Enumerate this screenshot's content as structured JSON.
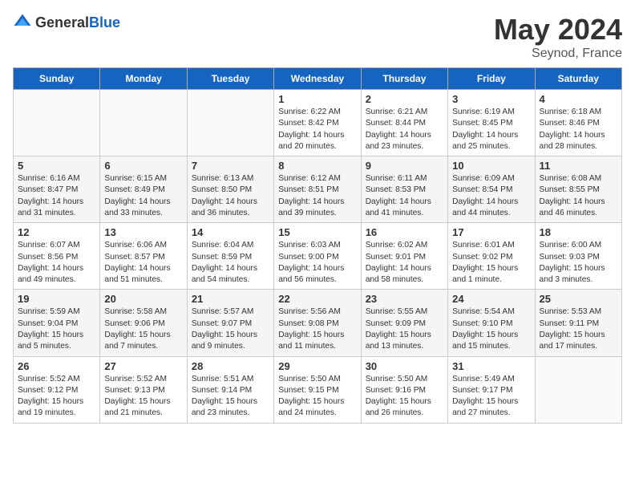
{
  "header": {
    "logo_general": "General",
    "logo_blue": "Blue",
    "main_title": "May 2024",
    "subtitle": "Seynod, France"
  },
  "days_of_week": [
    "Sunday",
    "Monday",
    "Tuesday",
    "Wednesday",
    "Thursday",
    "Friday",
    "Saturday"
  ],
  "weeks": [
    {
      "days": [
        {
          "num": "",
          "empty": true
        },
        {
          "num": "",
          "empty": true
        },
        {
          "num": "",
          "empty": true
        },
        {
          "num": "1",
          "sunrise": "6:22 AM",
          "sunset": "8:42 PM",
          "daylight": "14 hours and 20 minutes."
        },
        {
          "num": "2",
          "sunrise": "6:21 AM",
          "sunset": "8:44 PM",
          "daylight": "14 hours and 23 minutes."
        },
        {
          "num": "3",
          "sunrise": "6:19 AM",
          "sunset": "8:45 PM",
          "daylight": "14 hours and 25 minutes."
        },
        {
          "num": "4",
          "sunrise": "6:18 AM",
          "sunset": "8:46 PM",
          "daylight": "14 hours and 28 minutes."
        }
      ]
    },
    {
      "days": [
        {
          "num": "5",
          "sunrise": "6:16 AM",
          "sunset": "8:47 PM",
          "daylight": "14 hours and 31 minutes."
        },
        {
          "num": "6",
          "sunrise": "6:15 AM",
          "sunset": "8:49 PM",
          "daylight": "14 hours and 33 minutes."
        },
        {
          "num": "7",
          "sunrise": "6:13 AM",
          "sunset": "8:50 PM",
          "daylight": "14 hours and 36 minutes."
        },
        {
          "num": "8",
          "sunrise": "6:12 AM",
          "sunset": "8:51 PM",
          "daylight": "14 hours and 39 minutes."
        },
        {
          "num": "9",
          "sunrise": "6:11 AM",
          "sunset": "8:53 PM",
          "daylight": "14 hours and 41 minutes."
        },
        {
          "num": "10",
          "sunrise": "6:09 AM",
          "sunset": "8:54 PM",
          "daylight": "14 hours and 44 minutes."
        },
        {
          "num": "11",
          "sunrise": "6:08 AM",
          "sunset": "8:55 PM",
          "daylight": "14 hours and 46 minutes."
        }
      ]
    },
    {
      "days": [
        {
          "num": "12",
          "sunrise": "6:07 AM",
          "sunset": "8:56 PM",
          "daylight": "14 hours and 49 minutes."
        },
        {
          "num": "13",
          "sunrise": "6:06 AM",
          "sunset": "8:57 PM",
          "daylight": "14 hours and 51 minutes."
        },
        {
          "num": "14",
          "sunrise": "6:04 AM",
          "sunset": "8:59 PM",
          "daylight": "14 hours and 54 minutes."
        },
        {
          "num": "15",
          "sunrise": "6:03 AM",
          "sunset": "9:00 PM",
          "daylight": "14 hours and 56 minutes."
        },
        {
          "num": "16",
          "sunrise": "6:02 AM",
          "sunset": "9:01 PM",
          "daylight": "14 hours and 58 minutes."
        },
        {
          "num": "17",
          "sunrise": "6:01 AM",
          "sunset": "9:02 PM",
          "daylight": "15 hours and 1 minute."
        },
        {
          "num": "18",
          "sunrise": "6:00 AM",
          "sunset": "9:03 PM",
          "daylight": "15 hours and 3 minutes."
        }
      ]
    },
    {
      "days": [
        {
          "num": "19",
          "sunrise": "5:59 AM",
          "sunset": "9:04 PM",
          "daylight": "15 hours and 5 minutes."
        },
        {
          "num": "20",
          "sunrise": "5:58 AM",
          "sunset": "9:06 PM",
          "daylight": "15 hours and 7 minutes."
        },
        {
          "num": "21",
          "sunrise": "5:57 AM",
          "sunset": "9:07 PM",
          "daylight": "15 hours and 9 minutes."
        },
        {
          "num": "22",
          "sunrise": "5:56 AM",
          "sunset": "9:08 PM",
          "daylight": "15 hours and 11 minutes."
        },
        {
          "num": "23",
          "sunrise": "5:55 AM",
          "sunset": "9:09 PM",
          "daylight": "15 hours and 13 minutes."
        },
        {
          "num": "24",
          "sunrise": "5:54 AM",
          "sunset": "9:10 PM",
          "daylight": "15 hours and 15 minutes."
        },
        {
          "num": "25",
          "sunrise": "5:53 AM",
          "sunset": "9:11 PM",
          "daylight": "15 hours and 17 minutes."
        }
      ]
    },
    {
      "days": [
        {
          "num": "26",
          "sunrise": "5:52 AM",
          "sunset": "9:12 PM",
          "daylight": "15 hours and 19 minutes."
        },
        {
          "num": "27",
          "sunrise": "5:52 AM",
          "sunset": "9:13 PM",
          "daylight": "15 hours and 21 minutes."
        },
        {
          "num": "28",
          "sunrise": "5:51 AM",
          "sunset": "9:14 PM",
          "daylight": "15 hours and 23 minutes."
        },
        {
          "num": "29",
          "sunrise": "5:50 AM",
          "sunset": "9:15 PM",
          "daylight": "15 hours and 24 minutes."
        },
        {
          "num": "30",
          "sunrise": "5:50 AM",
          "sunset": "9:16 PM",
          "daylight": "15 hours and 26 minutes."
        },
        {
          "num": "31",
          "sunrise": "5:49 AM",
          "sunset": "9:17 PM",
          "daylight": "15 hours and 27 minutes."
        },
        {
          "num": "",
          "empty": true
        }
      ]
    }
  ]
}
